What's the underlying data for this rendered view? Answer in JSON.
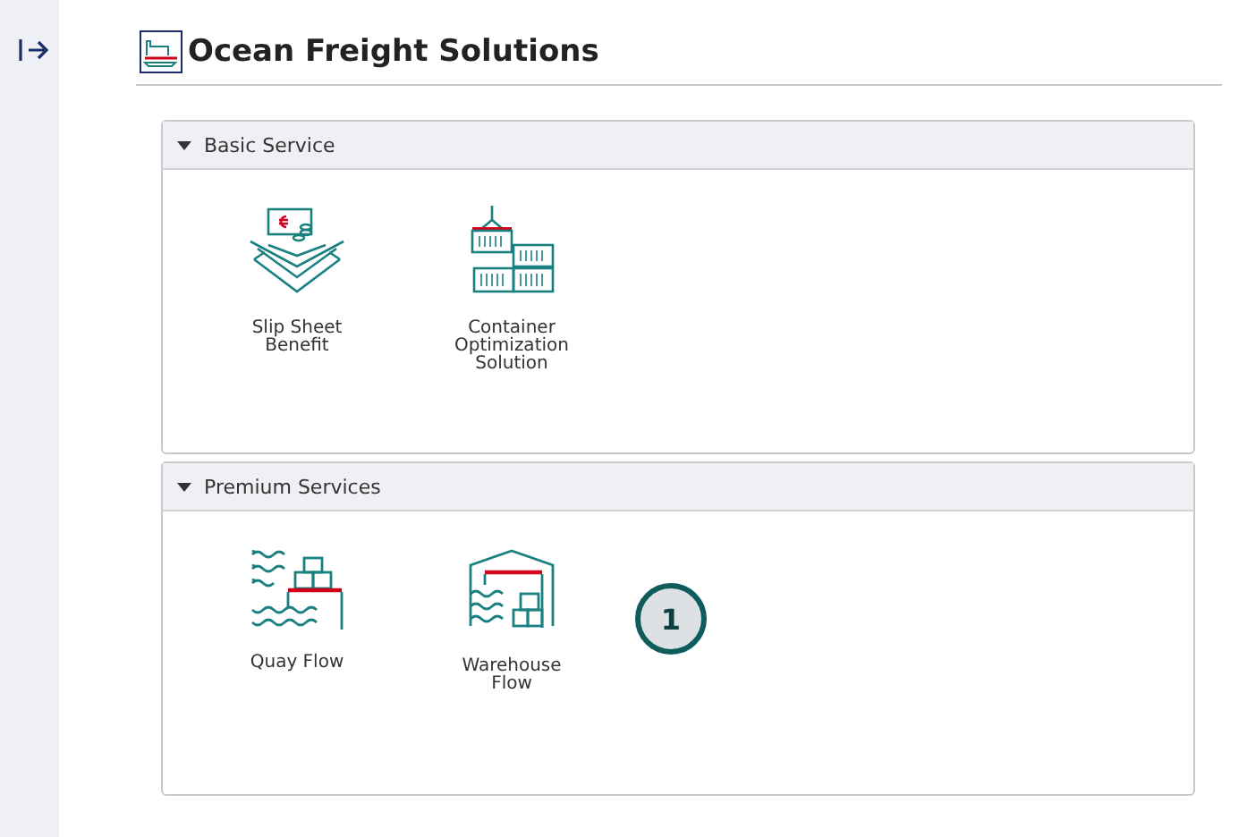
{
  "page": {
    "title": "Ocean Freight Solutions"
  },
  "sections": [
    {
      "title": "Basic Service",
      "expanded": true,
      "tiles": [
        {
          "kind": "slip-sheet",
          "label": "Slip Sheet Benefit"
        },
        {
          "kind": "container",
          "label": "Container Optimization Solution"
        }
      ]
    },
    {
      "title": "Premium Services",
      "expanded": true,
      "tiles": [
        {
          "kind": "quay",
          "label": "Quay Flow"
        },
        {
          "kind": "warehouse",
          "label": "Warehouse Flow",
          "badge": "1"
        }
      ]
    }
  ]
}
